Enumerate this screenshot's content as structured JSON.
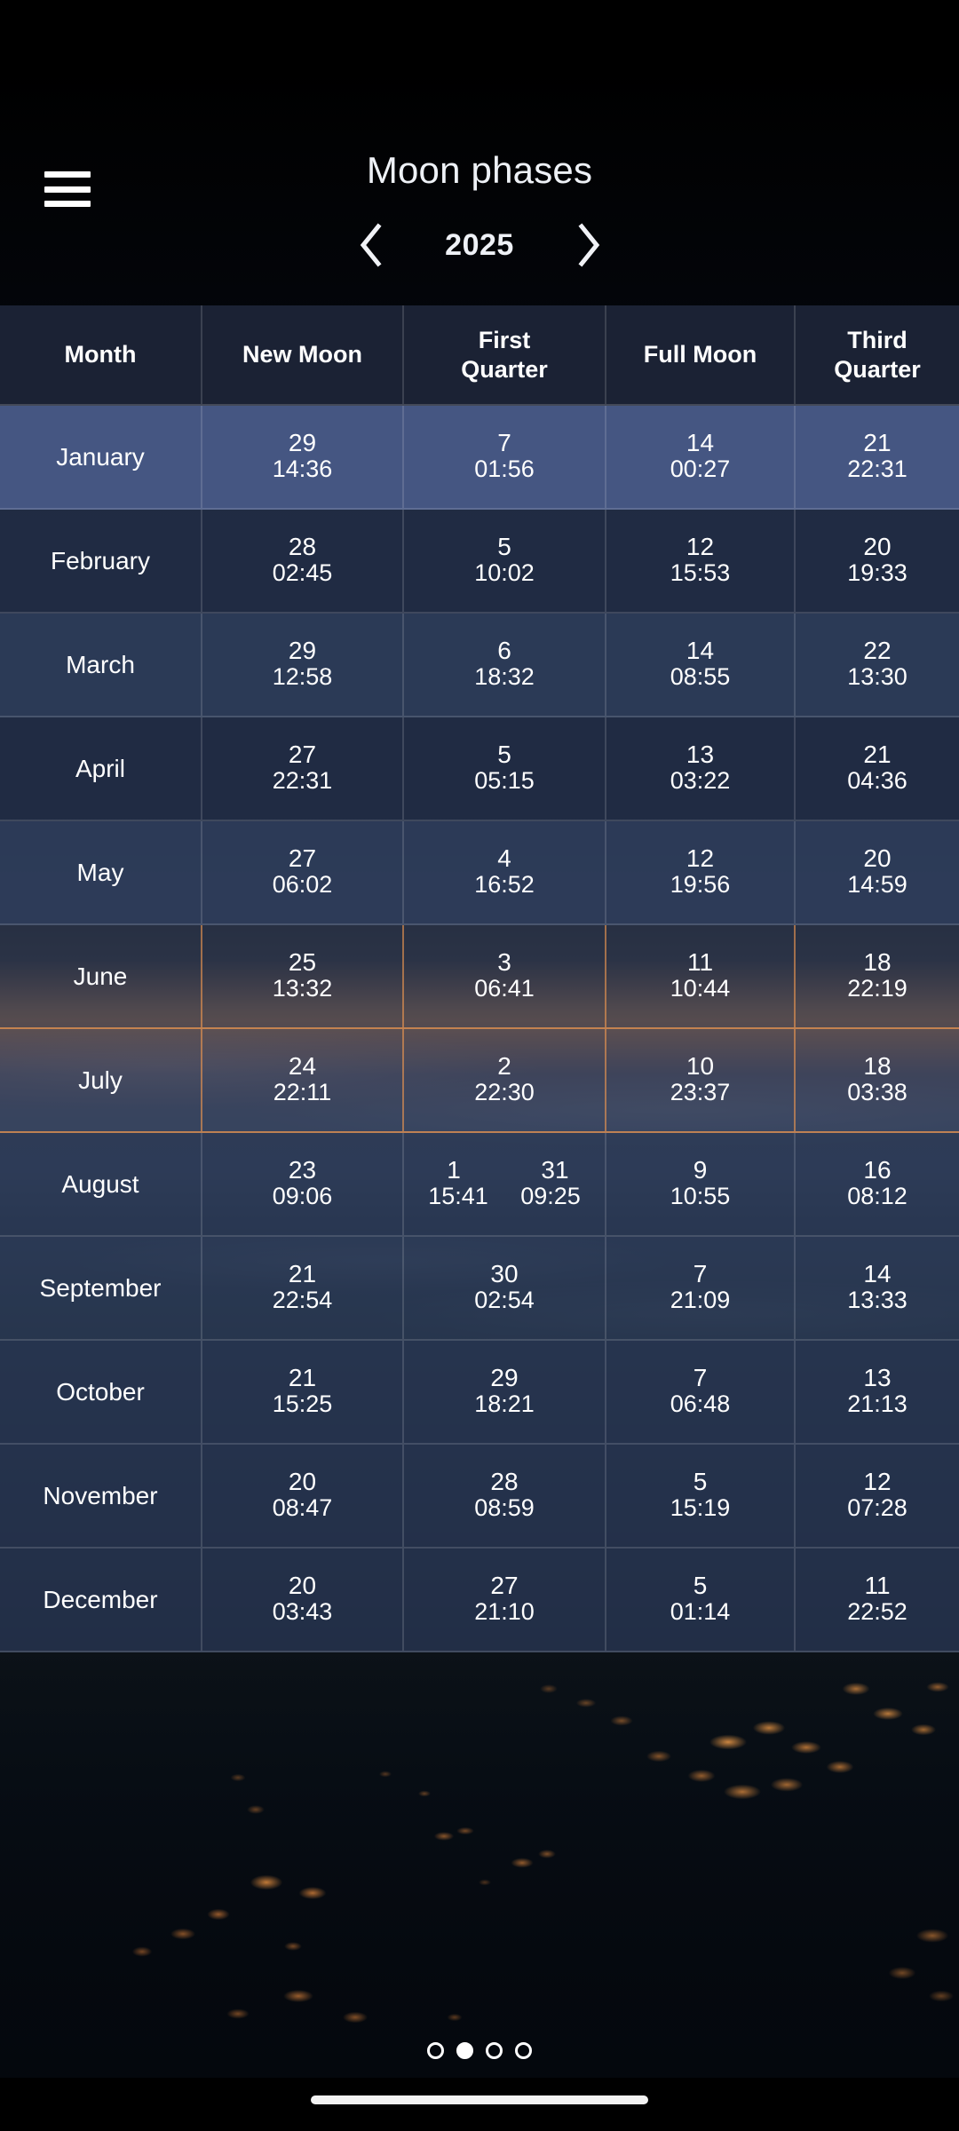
{
  "app": {
    "title": "Moon phases",
    "menu_icon": "hamburger-menu-icon"
  },
  "year_nav": {
    "prev_icon": "chevron-left-icon",
    "next_icon": "chevron-right-icon",
    "year": "2025"
  },
  "table": {
    "headers": [
      "Month",
      "New Moon",
      "First Quarter",
      "Full Moon",
      "Third Quarter"
    ],
    "rows": [
      {
        "month": "January",
        "new_moon": {
          "day": "29",
          "time": "14:36"
        },
        "first_quarter": {
          "day": "7",
          "time": "01:56"
        },
        "full_moon": {
          "day": "14",
          "time": "00:27"
        },
        "third_quarter": {
          "day": "21",
          "time": "22:31"
        }
      },
      {
        "month": "February",
        "new_moon": {
          "day": "28",
          "time": "02:45"
        },
        "first_quarter": {
          "day": "5",
          "time": "10:02"
        },
        "full_moon": {
          "day": "12",
          "time": "15:53"
        },
        "third_quarter": {
          "day": "20",
          "time": "19:33"
        }
      },
      {
        "month": "March",
        "new_moon": {
          "day": "29",
          "time": "12:58"
        },
        "first_quarter": {
          "day": "6",
          "time": "18:32"
        },
        "full_moon": {
          "day": "14",
          "time": "08:55"
        },
        "third_quarter": {
          "day": "22",
          "time": "13:30"
        }
      },
      {
        "month": "April",
        "new_moon": {
          "day": "27",
          "time": "22:31"
        },
        "first_quarter": {
          "day": "5",
          "time": "05:15"
        },
        "full_moon": {
          "day": "13",
          "time": "03:22"
        },
        "third_quarter": {
          "day": "21",
          "time": "04:36"
        }
      },
      {
        "month": "May",
        "new_moon": {
          "day": "27",
          "time": "06:02"
        },
        "first_quarter": {
          "day": "4",
          "time": "16:52"
        },
        "full_moon": {
          "day": "12",
          "time": "19:56"
        },
        "third_quarter": {
          "day": "20",
          "time": "14:59"
        }
      },
      {
        "month": "June",
        "new_moon": {
          "day": "25",
          "time": "13:32"
        },
        "first_quarter": {
          "day": "3",
          "time": "06:41"
        },
        "full_moon": {
          "day": "11",
          "time": "10:44"
        },
        "third_quarter": {
          "day": "18",
          "time": "22:19"
        }
      },
      {
        "month": "July",
        "new_moon": {
          "day": "24",
          "time": "22:11"
        },
        "first_quarter": {
          "day": "2",
          "time": "22:30"
        },
        "full_moon": {
          "day": "10",
          "time": "23:37"
        },
        "third_quarter": {
          "day": "18",
          "time": "03:38"
        }
      },
      {
        "month": "August",
        "new_moon": {
          "day": "23",
          "time": "09:06"
        },
        "first_quarter": {
          "day": "1",
          "time": "15:41",
          "day2": "31",
          "time2": "09:25"
        },
        "full_moon": {
          "day": "9",
          "time": "10:55"
        },
        "third_quarter": {
          "day": "16",
          "time": "08:12"
        }
      },
      {
        "month": "September",
        "new_moon": {
          "day": "21",
          "time": "22:54"
        },
        "first_quarter": {
          "day": "30",
          "time": "02:54"
        },
        "full_moon": {
          "day": "7",
          "time": "21:09"
        },
        "third_quarter": {
          "day": "14",
          "time": "13:33"
        }
      },
      {
        "month": "October",
        "new_moon": {
          "day": "21",
          "time": "15:25"
        },
        "first_quarter": {
          "day": "29",
          "time": "18:21"
        },
        "full_moon": {
          "day": "7",
          "time": "06:48"
        },
        "third_quarter": {
          "day": "13",
          "time": "21:13"
        }
      },
      {
        "month": "November",
        "new_moon": {
          "day": "20",
          "time": "08:47"
        },
        "first_quarter": {
          "day": "28",
          "time": "08:59"
        },
        "full_moon": {
          "day": "5",
          "time": "15:19"
        },
        "third_quarter": {
          "day": "12",
          "time": "07:28"
        }
      },
      {
        "month": "December",
        "new_moon": {
          "day": "20",
          "time": "03:43"
        },
        "first_quarter": {
          "day": "27",
          "time": "21:10"
        },
        "full_moon": {
          "day": "5",
          "time": "01:14"
        },
        "third_quarter": {
          "day": "11",
          "time": "22:52"
        }
      }
    ],
    "highlighted_row": "January"
  },
  "pagination": {
    "total": 4,
    "active_index": 1
  },
  "colors": {
    "header_bg": "#1b2234",
    "row_highlight": "#485a87",
    "row_dark": "#222d46",
    "row_mid": "#2f3e5c",
    "text": "#ffffff",
    "warm_border": "#eb9650"
  }
}
